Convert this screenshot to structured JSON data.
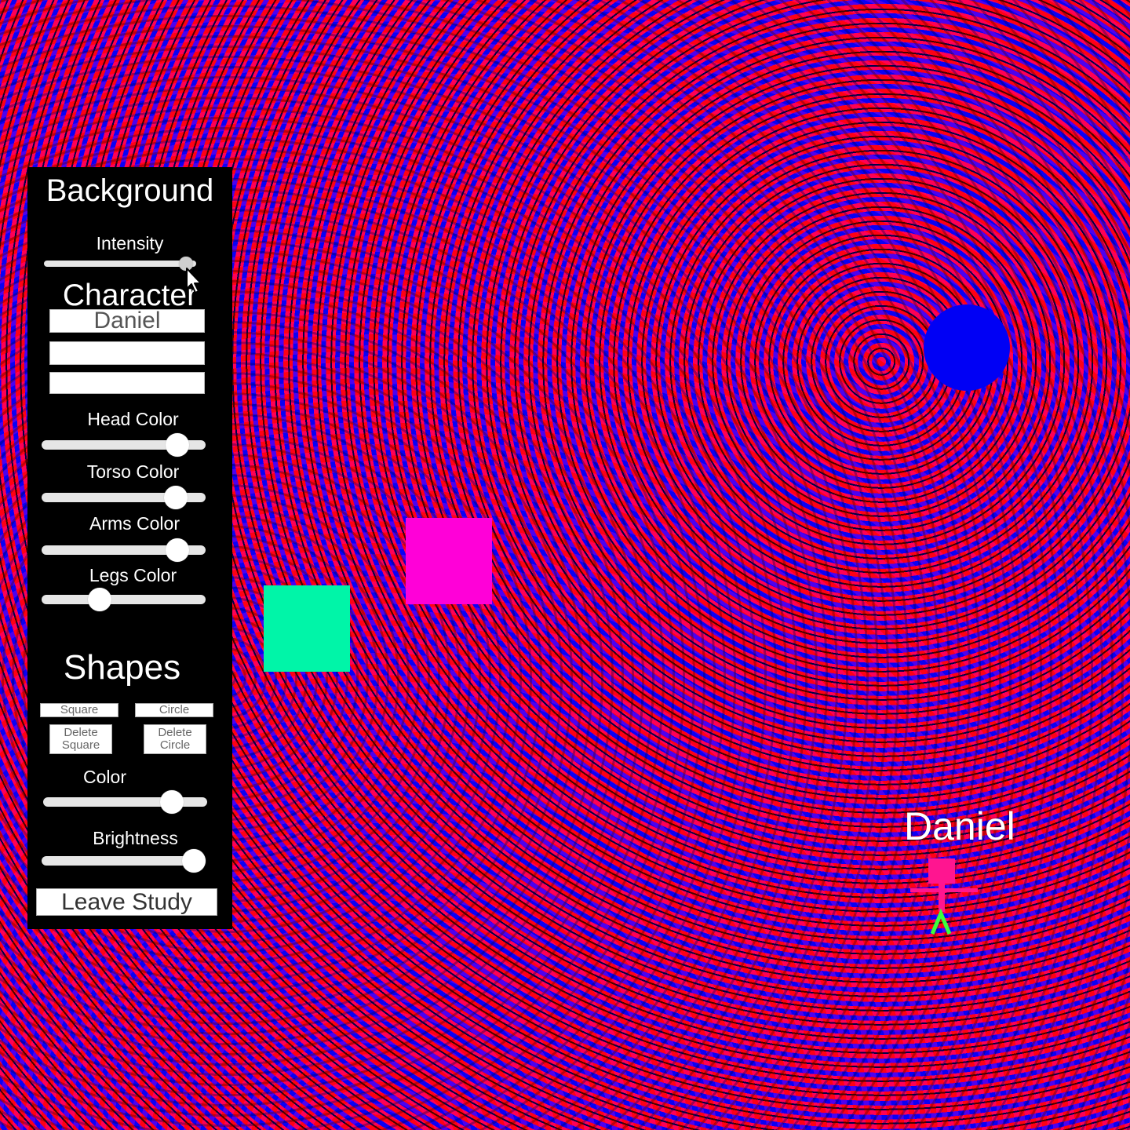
{
  "panel": {
    "background": {
      "heading": "Background",
      "intensity_label": "Intensity",
      "intensity_value": 0.98
    },
    "character": {
      "heading": "Character",
      "name_value": "Daniel",
      "field2_value": "",
      "field3_value": "",
      "head_color_label": "Head Color",
      "head_color_value": 0.88,
      "torso_color_label": "Torso Color",
      "torso_color_value": 0.87,
      "arms_color_label": "Arms Color",
      "arms_color_value": 0.88,
      "legs_color_label": "Legs Color",
      "legs_color_value": 0.33
    },
    "shapes": {
      "heading": "Shapes",
      "square_label": "Square",
      "circle_label": "Circle",
      "delete_square_line1": "Delete",
      "delete_square_line2": "Square",
      "delete_circle_line1": "Delete",
      "delete_circle_line2": "Circle",
      "color_label": "Color",
      "color_value": 0.83,
      "brightness_label": "Brightness",
      "brightness_value": 1.0
    },
    "leave_label": "Leave Study"
  },
  "scene": {
    "character_label": "Daniel",
    "colors": {
      "square_1": "#00f5a8",
      "square_2": "#ff00d8",
      "circle": "#0000f5",
      "avatar_head": "#ff1590",
      "avatar_torso": "#ff1590",
      "avatar_arms": "#ff1590",
      "avatar_legs": "#3cff3c"
    },
    "icons": [
      "mouse-cursor-icon"
    ]
  }
}
